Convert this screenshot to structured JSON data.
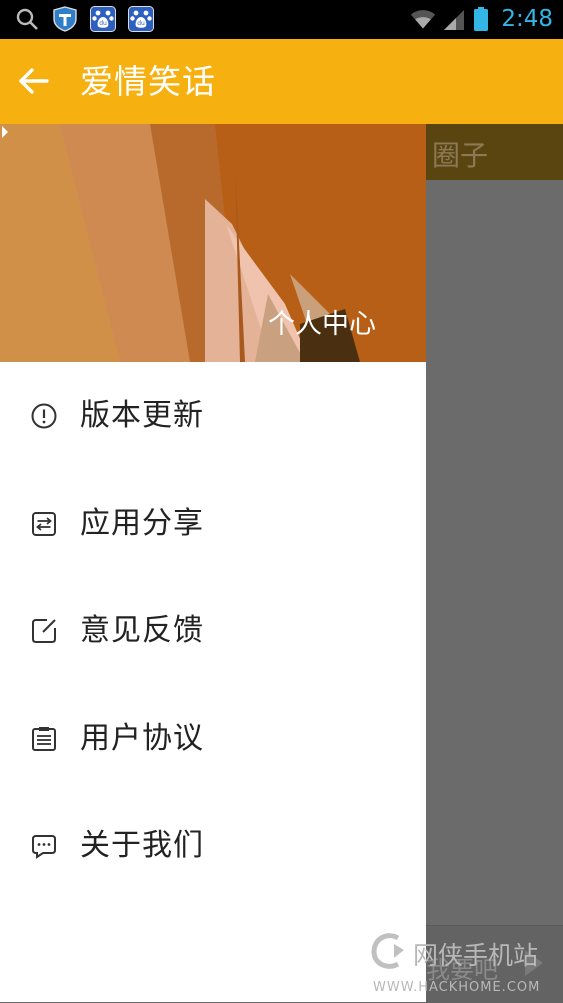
{
  "status_bar": {
    "time": "2:48",
    "icons": [
      "search-icon",
      "shield-icon",
      "baidu-paw-icon",
      "baidu-paw-icon",
      "wifi-icon",
      "signal-icon",
      "battery-icon"
    ],
    "accent": "#33b5e5"
  },
  "app_bar": {
    "title": "爱情笑话",
    "background": "#f6b010"
  },
  "drawer": {
    "profile_link": "个人中心",
    "items": [
      {
        "label": "版本更新",
        "icon": "info-icon"
      },
      {
        "label": "应用分享",
        "icon": "share-icon"
      },
      {
        "label": "意见反馈",
        "icon": "edit-icon"
      },
      {
        "label": "用户协议",
        "icon": "document-icon"
      },
      {
        "label": "关于我们",
        "icon": "chat-icon"
      }
    ]
  },
  "background_page": {
    "tab_label": "圈子",
    "bottom_label": "我要吧"
  },
  "watermark": {
    "text": "网侠手机站",
    "url": "WWW.HACKHOME.COM"
  }
}
